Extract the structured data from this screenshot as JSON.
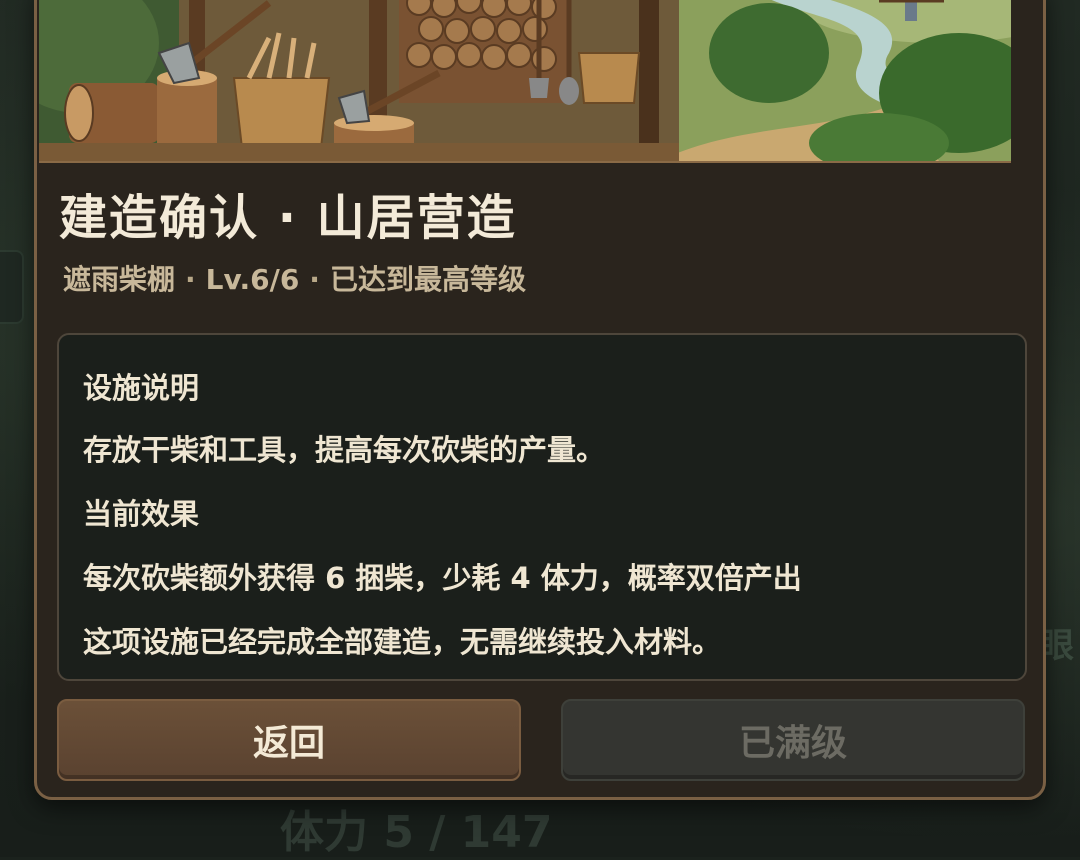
{
  "modal": {
    "title": "建造确认 · 山居营造",
    "subtitle": {
      "facility_name": "遮雨柴棚",
      "level": "Lv.6/6",
      "status": "已达到最高等级",
      "separator": "·"
    },
    "info": {
      "desc_heading": "设施说明",
      "desc_text": "存放干柴和工具，提高每次砍柴的产量。",
      "effect_heading": "当前效果",
      "effect_text": "每次砍柴额外获得 6 捆柴，少耗 4 体力，概率双倍产出",
      "complete_text": "这项设施已经完成全部建造，无需继续投入材料。"
    },
    "buttons": {
      "back_label": "返回",
      "max_label": "已满级"
    }
  },
  "background": {
    "right_text": "眼",
    "stamina_text": "体力 5 / 147"
  },
  "colors": {
    "modal_bg": "#2a241d",
    "modal_border": "#7a6044",
    "title": "#f3ead8",
    "subtitle": "#c8b89a",
    "panel_bg": "#1b1f1b",
    "back_button": "#5f4632",
    "max_button_disabled": "#343531"
  }
}
